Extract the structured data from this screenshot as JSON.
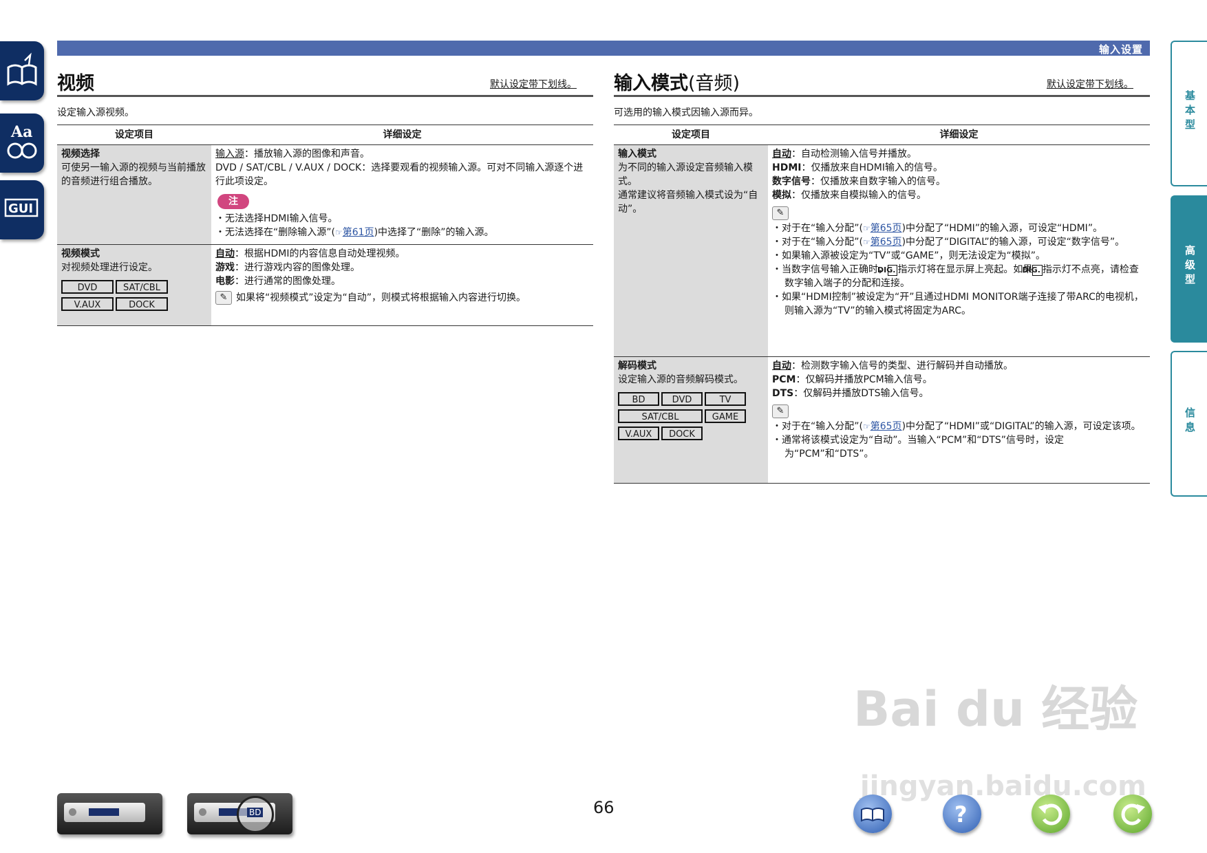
{
  "header": {
    "title": "输入设置"
  },
  "left_icons": [
    {
      "name": "book-icon"
    },
    {
      "name": "font-icon",
      "label": "Aa"
    },
    {
      "name": "gui-icon",
      "label": "GUI"
    }
  ],
  "right_tabs": [
    {
      "label": "基本型",
      "active": false
    },
    {
      "label": "高级型",
      "active": true
    },
    {
      "label": "信息",
      "active": false
    }
  ],
  "left_section": {
    "title": "视频",
    "default_note": "默认设定带下划线。",
    "intro": "设定输入源视频。",
    "col_item": "设定项目",
    "col_detail": "详细设定",
    "rows": [
      {
        "item_title": "视频选择",
        "item_desc": "可使另一输入源的视频与当前播放的音频进行组合播放。",
        "detail_line1_label": "输入源",
        "detail_line1_text": "：播放输入源的图像和声音。",
        "detail_line2_label": "DVD / SAT/CBL / V.AUX / DOCK",
        "detail_line2_text": "：选择要观看的视频输入源。可对不同输入源逐个进行此项设定。",
        "note_label": "注",
        "notes": [
          "无法选择HDMI输入信号。",
          "无法选择在“删除输入源”("
        ],
        "note_link": "第61页",
        "note2_tail": ")中选择了“删除”的输入源。"
      },
      {
        "item_title": "视频模式",
        "item_desc": "对视频处理进行设定。",
        "sources": [
          "DVD",
          "SAT/CBL",
          "V.AUX",
          "DOCK"
        ],
        "d1_label": "自动",
        "d1_text": "：根据HDMI的内容信息自动处理视频。",
        "d2_label": "游戏",
        "d2_text": "：进行游戏内容的图像处理。",
        "d3_label": "电影",
        "d3_text": "：进行通常的图像处理。",
        "tip": "如果将“视频模式”设定为“自动”，则模式将根据输入内容进行切换。"
      }
    ]
  },
  "right_section": {
    "title": "输入模式",
    "title_light": "(音频)",
    "default_note": "默认设定带下划线。",
    "intro": "可选用的输入模式因输入源而异。",
    "col_item": "设定项目",
    "col_detail": "详细设定",
    "rows": [
      {
        "item_title": "输入模式",
        "item_desc1": "为不同的输入源设定音频输入模式。",
        "item_desc2": "通常建议将音频输入模式设为“自动”。",
        "d1_label": "自动",
        "d1_text": "：自动检测输入信号并播放。",
        "d2_label": "HDMI",
        "d2_text": "：仅播放来自HDMI输入的信号。",
        "d3_label": "数字信号",
        "d3_text": "：仅播放来自数字输入的信号。",
        "d4_label": "模拟",
        "d4_text": "：仅播放来自模拟输入的信号。",
        "b1_pre": "对于在“输入分配”(",
        "b1_link": "第65页",
        "b1_post": ")中分配了“HDMI”的输入源，可设定“HDMI”。",
        "b2_pre": "对于在“输入分配”(",
        "b2_link": "第65页",
        "b2_post": ")中分配了“DIGITAL”的输入源，可设定“数字信号”。",
        "b3": "如果输入源被设定为“TV”或“GAME”，则无法设定为“模拟”。",
        "b4_pre": "当数字信号输入正确时，",
        "b4_dig": "DIG.",
        "b4_mid": "指示灯将在显示屏上亮起。如果",
        "b4_post": "指示灯不点亮，请检查数字输入端子的分配和连接。",
        "b5": "如果“HDMI控制”被设定为“开”且通过HDMI MONITOR端子连接了带ARC的电视机，则输入源为“TV”的输入模式将固定为ARC。"
      },
      {
        "item_title": "解码模式",
        "item_desc": "设定输入源的音频解码模式。",
        "sources_r1": [
          "BD",
          "DVD",
          "TV"
        ],
        "sources_r2": [
          "SAT/CBL",
          "GAME"
        ],
        "sources_r3": [
          "V.AUX",
          "DOCK"
        ],
        "d1_label": "自动",
        "d1_text": "：检测数字输入信号的类型、进行解码并自动播放。",
        "d2_label": "PCM",
        "d2_text": "：仅解码并播放PCM输入信号。",
        "d3_label": "DTS",
        "d3_text": "：仅解码并播放DTS输入信号。",
        "b1_pre": "对于在“输入分配”(",
        "b1_link": "第65页",
        "b1_post": ")中分配了“HDMI”或“DIGITAL”的输入源，可设定该项。",
        "b2": "通常将该模式设定为“自动”。当输入“PCM”和“DTS”信号时，设定为“PCM”和“DTS”。"
      }
    ]
  },
  "footer": {
    "page_number": "66",
    "device2_label": "BD",
    "watermark": "Bai du 经验",
    "watermark2": "jingyan.baidu.com"
  }
}
